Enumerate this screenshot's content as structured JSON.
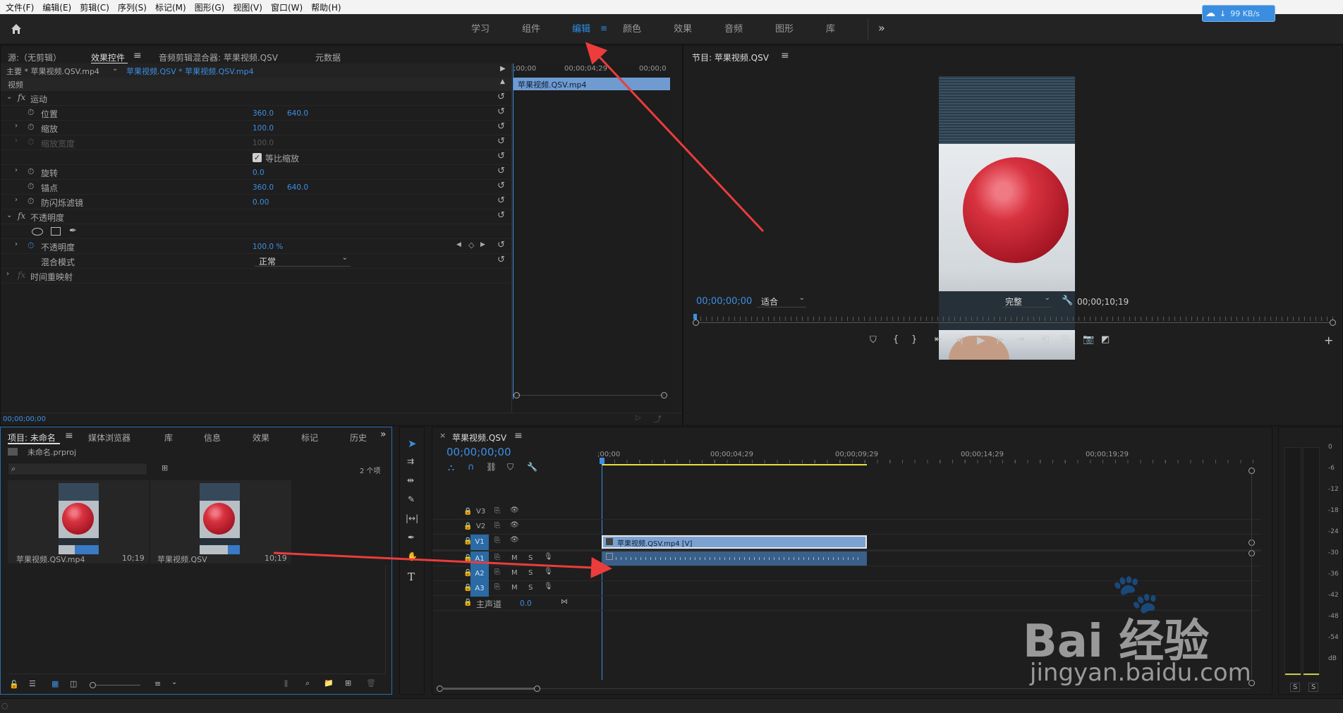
{
  "menu": [
    "文件(F)",
    "编辑(E)",
    "剪辑(C)",
    "序列(S)",
    "标记(M)",
    "图形(G)",
    "视图(V)",
    "窗口(W)",
    "帮助(H)"
  ],
  "net_speed": "99 KB/s",
  "workspaces": [
    "学习",
    "组件",
    "编辑",
    "颜色",
    "效果",
    "音频",
    "图形",
    "库"
  ],
  "active_workspace": "编辑",
  "source_panel": {
    "tabs": [
      "源:（无剪辑）",
      "效果控件",
      "音频剪辑混合器: 苹果视频.QSV",
      "元数据"
    ],
    "master_clip": "主要 * 苹果视频.QSV.mp4",
    "sequence_clip": "苹果视频.QSV * 苹果视频.QSV.mp4",
    "video_header": "视频",
    "sections": {
      "motion": "运动",
      "opacity": "不透明度",
      "time_remap": "时间重映射"
    },
    "props": {
      "position": {
        "label": "位置",
        "x": "360.0",
        "y": "640.0"
      },
      "scale": {
        "label": "缩放",
        "value": "100.0"
      },
      "scale_width": {
        "label": "缩放宽度",
        "value": "100.0"
      },
      "uniform_scale": "等比缩放",
      "rotation": {
        "label": "旋转",
        "value": "0.0"
      },
      "anchor": {
        "label": "锚点",
        "x": "360.0",
        "y": "640.0"
      },
      "antiflicker": {
        "label": "防闪烁滤镜",
        "value": "0.00"
      },
      "opacity": {
        "label": "不透明度",
        "value": "100.0 %"
      },
      "blend": {
        "label": "混合模式",
        "value": "正常"
      }
    },
    "mini_timeline": {
      "ticks": [
        ";00;00",
        "00;00;04;29",
        "00;00;0"
      ],
      "clip": "苹果视频.QSV.mp4"
    },
    "timecode": "00;00;00;00"
  },
  "program_panel": {
    "title": "节目: 苹果视频.QSV",
    "timecode": "00;00;00;00",
    "fit": "适合",
    "quality": "完整",
    "duration": "00;00;10;19"
  },
  "project_panel": {
    "tabs": [
      "项目: 未命名",
      "媒体浏览器",
      "库",
      "信息",
      "效果",
      "标记",
      "历史"
    ],
    "file": "未命名.prproj",
    "item_count": "2 个项",
    "items": [
      {
        "name": "苹果视频.QSV.mp4",
        "duration": "10;19"
      },
      {
        "name": "苹果视频.QSV",
        "duration": "10;19"
      }
    ]
  },
  "timeline": {
    "title": "苹果视频.QSV",
    "timecode": "00;00;00;00",
    "ticks": [
      ";00;00",
      "00;00;04;29",
      "00;00;09;29",
      "00;00;14;29",
      "00;00;19;29"
    ],
    "video_tracks": [
      "V3",
      "V2",
      "V1"
    ],
    "audio_tracks": [
      "A1",
      "A2",
      "A3"
    ],
    "master": {
      "label": "主声道",
      "value": "0.0"
    },
    "clip_label": "苹果视频.QSV.mp4 [V]",
    "m": "M",
    "s": "S"
  },
  "meter": {
    "scale": [
      "0",
      "-6",
      "-12",
      "-18",
      "-24",
      "-30",
      "-36",
      "-42",
      "-48",
      "-54",
      "dB"
    ],
    "solo": [
      "S",
      "S"
    ]
  },
  "watermark": {
    "brand": "Bai 经验",
    "url": "jingyan.baidu.com"
  }
}
